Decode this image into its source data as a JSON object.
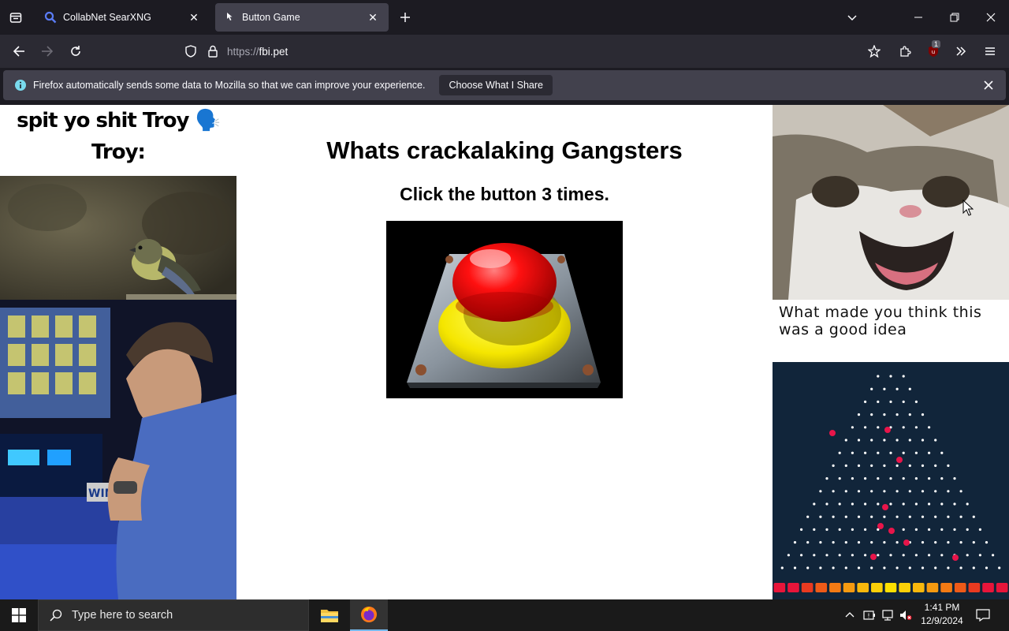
{
  "browser": {
    "tabs": [
      {
        "title": "CollabNet SearXNG",
        "active": false
      },
      {
        "title": "Button Game",
        "active": true
      }
    ],
    "url_scheme": "https://",
    "url_host": "fbi.pet",
    "extension_badge": "1"
  },
  "infobar": {
    "message": "Firefox automatically sends some data to Mozilla so that we can improve your experience.",
    "button_label": "Choose What I Share"
  },
  "page": {
    "left_meme_text": "spit yo shit Troy 🗣️",
    "left_meme_text2": "Troy:",
    "heading": "Whats crackalaking Gangsters",
    "subheading": "Click the button 3 times.",
    "cat_caption": "What made you think this was a good idea"
  },
  "taskbar": {
    "search_placeholder": "Type here to search",
    "time": "1:41 PM",
    "date": "12/9/2024"
  },
  "colors": {
    "button_red": "#e60000",
    "button_yellow": "#f5e600",
    "plinko_bg": "#11253a"
  }
}
